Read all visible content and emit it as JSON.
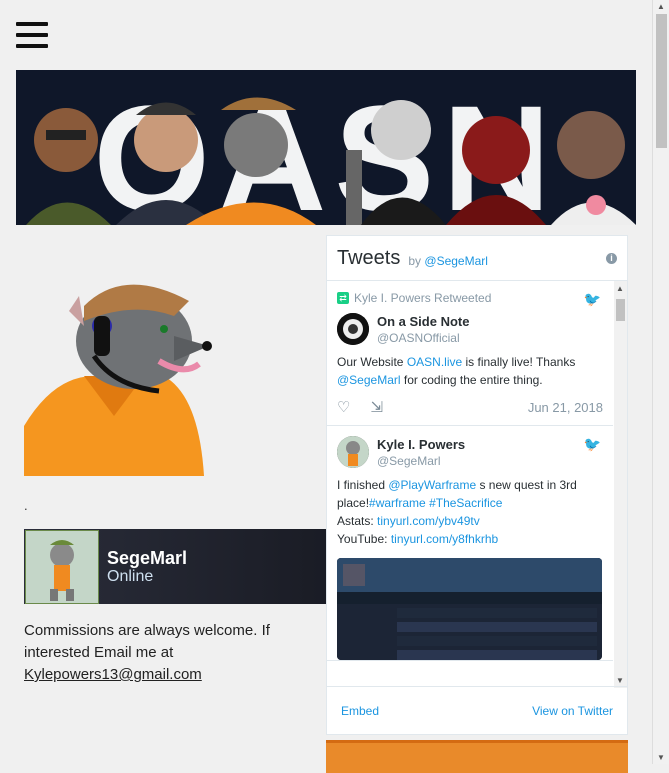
{
  "widget": {
    "title": "Tweets",
    "by": "by",
    "handle": "@SegeMarl",
    "embed": "Embed",
    "view_on": "View on Twitter"
  },
  "tweets": [
    {
      "retweet_label": "Kyle I. Powers Retweeted",
      "author": "On a Side Note",
      "handle": "@OASNOfficial",
      "text_parts": [
        "Our Website ",
        "OASN.live",
        " is finally live! Thanks ",
        "@SegeMarl",
        " for coding the entire thing."
      ],
      "date": "Jun 21, 2018"
    },
    {
      "author": "Kyle I. Powers",
      "handle": "@SegeMarl",
      "line1": [
        "I finished ",
        "@PlayWarframe",
        " s new quest in 3rd place!",
        "#warframe",
        " ",
        "#TheSacrifice"
      ],
      "line2": [
        "Astats: ",
        "tinyurl.com/ybv49tv"
      ],
      "line3": [
        "YouTube: ",
        "tinyurl.com/y8fhkrhb"
      ]
    }
  ],
  "profile": {
    "dot": ".",
    "steam_name": "SegeMarl",
    "steam_status": "Online",
    "commission_text": "Commissions are always welcome. If interested Email me at",
    "email": "Kylepowers13@gmail.com"
  },
  "colors": {
    "link": "#1b95e0",
    "banner_bg": "#0f1729",
    "accent_orange": "#e98a2a"
  }
}
